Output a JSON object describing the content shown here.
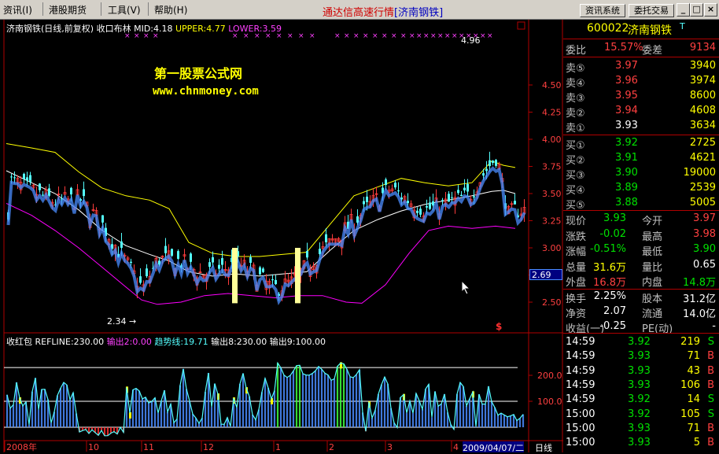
{
  "menu": {
    "items": [
      "资讯(I)",
      "港股期货",
      "工具(V)",
      "帮助(H)"
    ],
    "title": "通达信高速行情",
    "title_stock": "[济南钢铁]",
    "btn_news": "资讯系统",
    "btn_trade": "委托交易",
    "btn_min": "_",
    "btn_restore": "□",
    "btn_close": "×"
  },
  "main_chart": {
    "header": {
      "name": "济南钢铁(日线,前复权) 收口布林",
      "mid": "MID:4.18",
      "upper": "UPPER:4.77",
      "lower": "LOWER:3.59"
    },
    "watermark": {
      "cn": "第一股票公式网",
      "url": "www.chnmoney.com"
    },
    "high_label": "4.96",
    "low_label": "2.34",
    "current_price_tag": "2.69",
    "s_marker": "$",
    "y_ticks": [
      "4.50",
      "4.25",
      "4.00",
      "3.75",
      "3.50",
      "3.25",
      "3.00",
      "2.75",
      "2.50"
    ],
    "colors": {
      "up": "#ff3c3c",
      "down": "#54ffff",
      "mid": "#ffffff",
      "upper": "#ffff00",
      "lower": "#ff00ff",
      "ma_blue": "#4a8cff",
      "highlight": "#ffff99"
    }
  },
  "sub_chart": {
    "header": {
      "name": "收红包",
      "refline": "REFLINE:230.00",
      "out1": "输出2:0.00",
      "trend": "趋势线:19.71",
      "out3": "输出8:230.00",
      "out4": "输出9:100.00"
    },
    "y_ticks": [
      "200.0",
      "100.0"
    ]
  },
  "x_axis": {
    "labels": [
      "2008年",
      "10",
      "11",
      "12",
      "1",
      "2",
      "3",
      "4"
    ],
    "date_tag": "2009/04/07/二",
    "period": "日线"
  },
  "quote": {
    "code": "600022",
    "name": "济南钢铁",
    "t_mark": "T",
    "ratio_label": "委比",
    "ratio": "15.57%",
    "diff_label": "委差",
    "diff": "9134",
    "asks": [
      {
        "label": "卖⑤",
        "price": "3.97",
        "vol": "3940"
      },
      {
        "label": "卖④",
        "price": "3.96",
        "vol": "3974"
      },
      {
        "label": "卖③",
        "price": "3.95",
        "vol": "8600"
      },
      {
        "label": "卖②",
        "price": "3.94",
        "vol": "4608"
      },
      {
        "label": "卖①",
        "price": "3.93",
        "vol": "3634"
      }
    ],
    "bids": [
      {
        "label": "买①",
        "price": "3.92",
        "vol": "2725"
      },
      {
        "label": "买②",
        "price": "3.91",
        "vol": "4621"
      },
      {
        "label": "买③",
        "price": "3.90",
        "vol": "19000"
      },
      {
        "label": "买④",
        "price": "3.89",
        "vol": "2539"
      },
      {
        "label": "买⑤",
        "price": "3.88",
        "vol": "5005"
      }
    ],
    "stats": [
      {
        "l1": "现价",
        "v1": "3.93",
        "c1": "#00e000",
        "l2": "今开",
        "v2": "3.97",
        "c2": "#ff4040"
      },
      {
        "l1": "涨跌",
        "v1": "-0.02",
        "c1": "#00e000",
        "l2": "最高",
        "v2": "3.98",
        "c2": "#ff4040"
      },
      {
        "l1": "涨幅",
        "v1": "-0.51%",
        "c1": "#00e000",
        "l2": "最低",
        "v2": "3.90",
        "c2": "#00e000"
      },
      {
        "l1": "总量",
        "v1": "31.6万",
        "c1": "#ffff00",
        "l2": "量比",
        "v2": "0.65",
        "c2": "#ffffff"
      },
      {
        "l1": "外盘",
        "v1": "16.8万",
        "c1": "#ff4040",
        "l2": "内盘",
        "v2": "14.8万",
        "c2": "#00e000"
      }
    ],
    "stats2": [
      {
        "l1": "换手",
        "v1": "2.25%",
        "l2": "股本",
        "v2": "31.2亿"
      },
      {
        "l1": "净资",
        "v1": "2.07",
        "l2": "流通",
        "v2": "14.0亿"
      },
      {
        "l1": "收益(一)",
        "v1": "-0.25",
        "l2": "PE(动)",
        "v2": "-"
      }
    ],
    "ticks": [
      {
        "time": "14:59",
        "price": "3.92",
        "vol": "219",
        "side": "S"
      },
      {
        "time": "14:59",
        "price": "3.93",
        "vol": "71",
        "side": "B"
      },
      {
        "time": "14:59",
        "price": "3.93",
        "vol": "43",
        "side": "B"
      },
      {
        "time": "14:59",
        "price": "3.93",
        "vol": "106",
        "side": "B"
      },
      {
        "time": "14:59",
        "price": "3.92",
        "vol": "14",
        "side": "S"
      },
      {
        "time": "15:00",
        "price": "3.92",
        "vol": "105",
        "side": "S"
      },
      {
        "time": "15:00",
        "price": "3.93",
        "vol": "71",
        "side": "B"
      },
      {
        "time": "15:00",
        "price": "3.93",
        "vol": "5",
        "side": "B"
      }
    ]
  }
}
